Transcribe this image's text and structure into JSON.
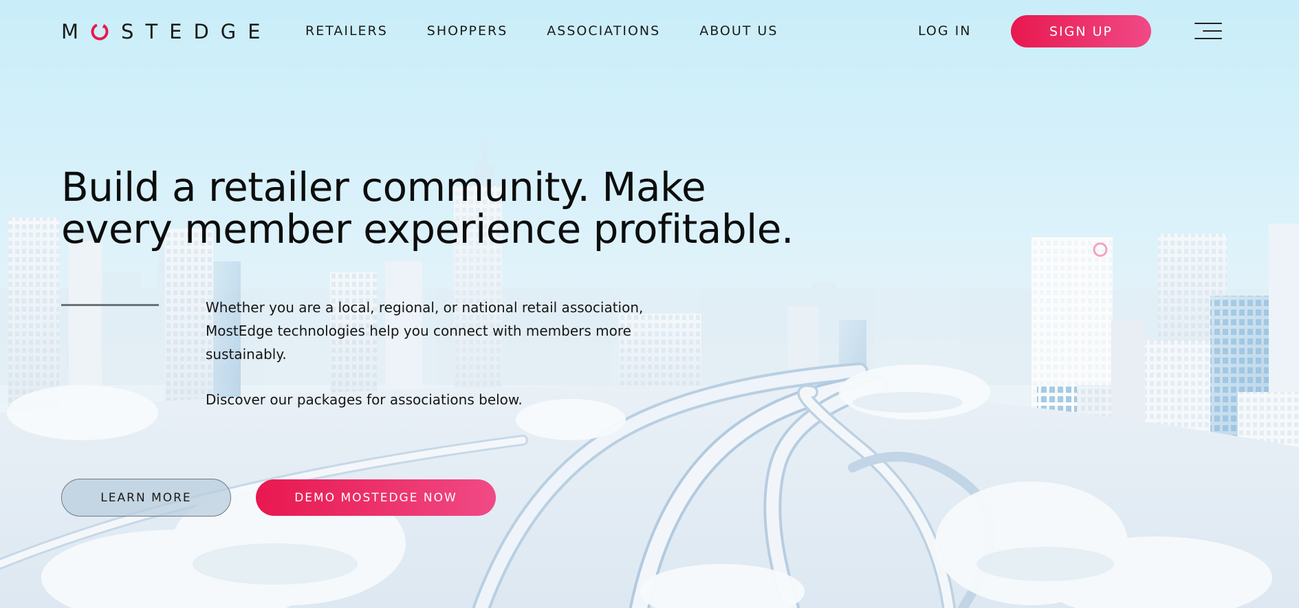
{
  "brand": {
    "logo_text": "MOSTEDGE",
    "logo_prefix": "M",
    "logo_suffix": "STEDGE",
    "accent_color": "#e8184f",
    "accent_color_end": "#f04a86"
  },
  "nav": {
    "items": [
      {
        "label": "RETAILERS"
      },
      {
        "label": "SHOPPERS"
      },
      {
        "label": "ASSOCIATIONS"
      },
      {
        "label": "ABOUT US"
      }
    ],
    "login_label": "LOG IN",
    "signup_label": "SIGN UP",
    "menu_icon": "hamburger-menu-icon"
  },
  "hero": {
    "headline_line1": "Build a retailer community. Make",
    "headline_line2": "every member experience profitable.",
    "description": "Whether you are a local, regional, or national retail association, MostEdge technologies help you connect with members more sustainably.",
    "sub_description": "Discover our packages for associations below.",
    "learn_more_label": "LEARN MORE",
    "demo_label": "DEMO MOSTEDGE NOW",
    "background": "snowy-city-highway-illustration"
  }
}
